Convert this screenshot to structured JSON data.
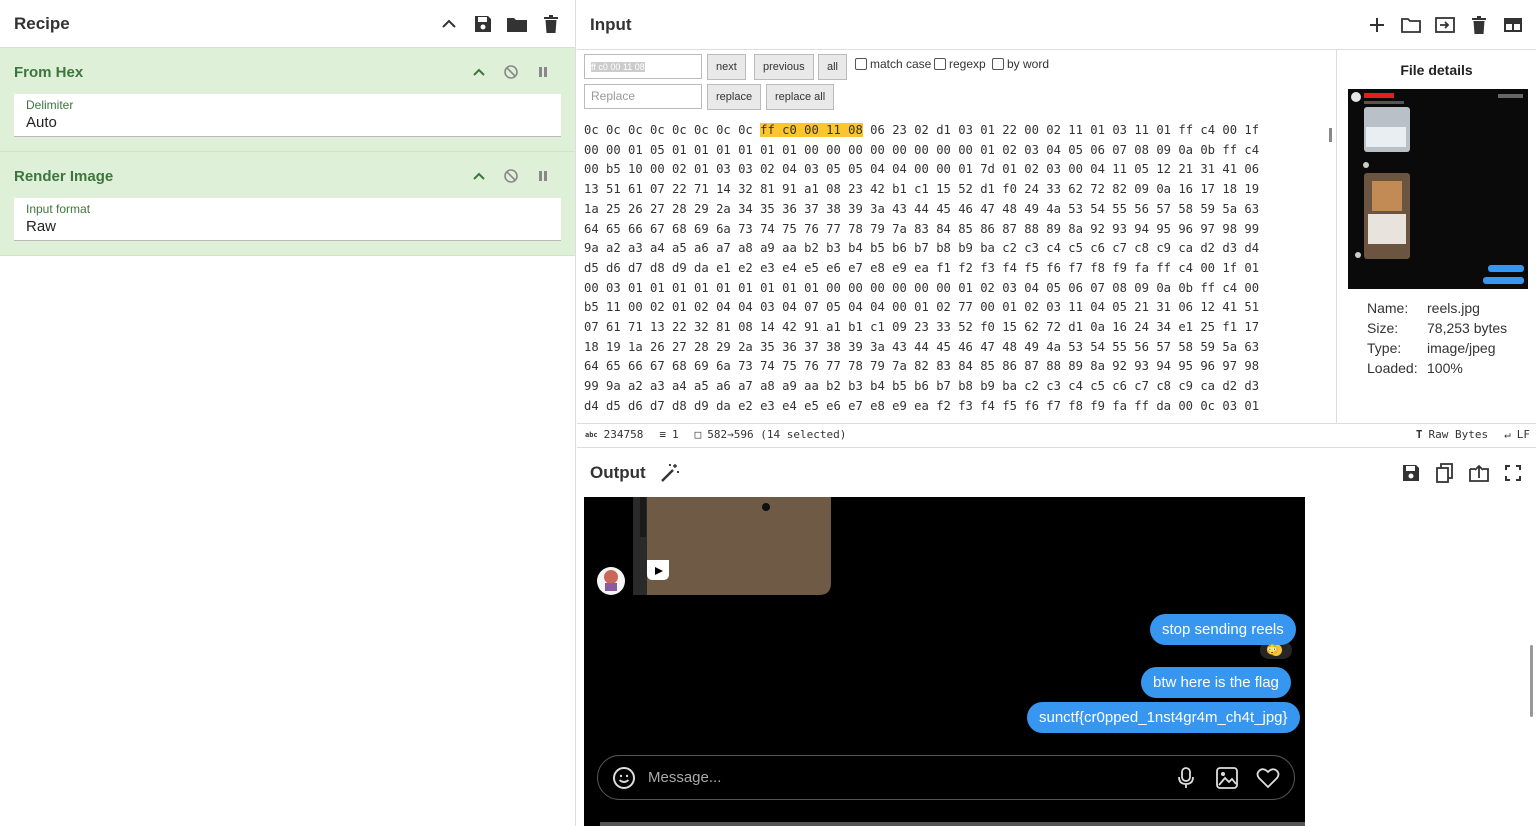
{
  "recipe": {
    "title": "Recipe",
    "operations": [
      {
        "name": "From Hex",
        "field_label": "Delimiter",
        "field_value": "Auto"
      },
      {
        "name": "Render Image",
        "field_label": "Input format",
        "field_value": "Raw"
      }
    ]
  },
  "input": {
    "title": "Input",
    "search_value": "ff c0 00 11 08",
    "replace_placeholder": "Replace",
    "buttons": {
      "next": "next",
      "previous": "previous",
      "all": "all",
      "replace": "replace",
      "replace_all": "replace all"
    },
    "options": {
      "match_case": "match case",
      "regexp": "regexp",
      "by_word": "by word"
    },
    "hex_lines": [
      "0c 0c 0c 0c 0c 0c 0c 0c |ff c0 00 11 08| 06 23 02 d1 03 01 22 00 02 11 01 03 11 01 ff c4 00 1f",
      "00 00 01 05 01 01 01 01 01 01 00 00 00 00 00 00 00 00 01 02 03 04 05 06 07 08 09 0a 0b ff c4",
      "00 b5 10 00 02 01 03 03 02 04 03 05 05 04 04 00 00 01 7d 01 02 03 00 04 11 05 12 21 31 41 06",
      "13 51 61 07 22 71 14 32 81 91 a1 08 23 42 b1 c1 15 52 d1 f0 24 33 62 72 82 09 0a 16 17 18 19",
      "1a 25 26 27 28 29 2a 34 35 36 37 38 39 3a 43 44 45 46 47 48 49 4a 53 54 55 56 57 58 59 5a 63",
      "64 65 66 67 68 69 6a 73 74 75 76 77 78 79 7a 83 84 85 86 87 88 89 8a 92 93 94 95 96 97 98 99",
      "9a a2 a3 a4 a5 a6 a7 a8 a9 aa b2 b3 b4 b5 b6 b7 b8 b9 ba c2 c3 c4 c5 c6 c7 c8 c9 ca d2 d3 d4",
      "d5 d6 d7 d8 d9 da e1 e2 e3 e4 e5 e6 e7 e8 e9 ea f1 f2 f3 f4 f5 f6 f7 f8 f9 fa ff c4 00 1f 01",
      "00 03 01 01 01 01 01 01 01 01 01 00 00 00 00 00 00 01 02 03 04 05 06 07 08 09 0a 0b ff c4 00",
      "b5 11 00 02 01 02 04 04 03 04 07 05 04 04 00 01 02 77 00 01 02 03 11 04 05 21 31 06 12 41 51",
      "07 61 71 13 22 32 81 08 14 42 91 a1 b1 c1 09 23 33 52 f0 15 62 72 d1 0a 16 24 34 e1 25 f1 17",
      "18 19 1a 26 27 28 29 2a 35 36 37 38 39 3a 43 44 45 46 47 48 49 4a 53 54 55 56 57 58 59 5a 63",
      "64 65 66 67 68 69 6a 73 74 75 76 77 78 79 7a 82 83 84 85 86 87 88 89 8a 92 93 94 95 96 97 98",
      "99 9a a2 a3 a4 a5 a6 a7 a8 a9 aa b2 b3 b4 b5 b6 b7 b8 b9 ba c2 c3 c4 c5 c6 c7 c8 c9 ca d2 d3",
      "d4 d5 d6 d7 d8 d9 da e2 e3 e4 e5 e6 e7 e8 e9 ea f2 f3 f4 f5 f6 f7 f8 f9 fa ff da 00 0c 03 01"
    ],
    "status": {
      "length": "234758",
      "lines": "1",
      "selection": "582→596 (14 selected)",
      "encoding": "Raw Bytes",
      "eol": "LF"
    }
  },
  "file_details": {
    "title": "File details",
    "rows": [
      {
        "key": "Name:",
        "value": "reels.jpg"
      },
      {
        "key": "Size:",
        "value": "78,253 bytes"
      },
      {
        "key": "Type:",
        "value": "image/jpeg"
      },
      {
        "key": "Loaded:",
        "value": "100%"
      }
    ]
  },
  "output": {
    "title": "Output",
    "messages": [
      {
        "text": "stop sending reels",
        "reaction": "😳"
      },
      {
        "text": "btw here is the flag"
      },
      {
        "text": "sunctf{cr0pped_1nst4gr4m_ch4t_jpg}"
      }
    ],
    "message_placeholder": "Message..."
  }
}
